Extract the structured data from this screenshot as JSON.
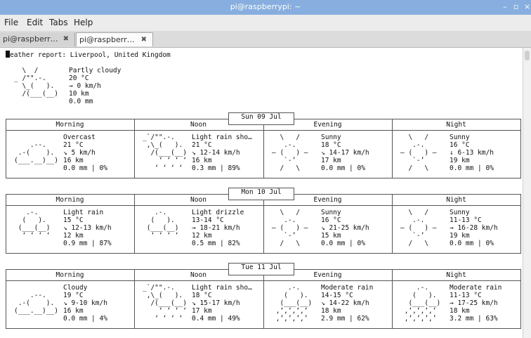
{
  "window": {
    "title": "pi@raspberrypi: ~",
    "minimize": "–",
    "maximize": "▫",
    "close": "×"
  },
  "menu": [
    "File",
    "Edit",
    "Tabs",
    "Help"
  ],
  "tabs": [
    {
      "label": "pi@raspberr…",
      "close": "✖"
    },
    {
      "label": "pi@raspberr…",
      "close": "✖"
    }
  ],
  "report": {
    "cursor_char": "W",
    "header_rest": "eather report: Liverpool, United Kingdom",
    "current": {
      "art": "  \\  /\n_ /\"\".-.\n  \\_(   ).\n  /(___(__)",
      "info": "Partly cloudy\n20 °C\n→ 0 km/h\n10 km\n0.0 mm"
    }
  },
  "columns": [
    "Morning",
    "Noon",
    "Evening",
    "Night"
  ],
  "days": [
    {
      "date": "Sun 09 Jul",
      "cells": [
        {
          "art": "\n    .--.\n .-(    ).\n(___.__)__)",
          "info": "Overcast\n21 °C\n↘ 5 km/h\n16 km\n0.0 mm | 0%"
        },
        {
          "art": "_`/\"\".-.\n ,\\_(   ).\n  /(___(__)\n    ‘ ‘ ‘ ‘\n   ‘ ‘ ‘ ‘",
          "info": "Light rain sho…\n21 °C\n↘ 12-14 km/h\n16 km\n0.3 mm | 89%"
        },
        {
          "art": "  \\   /\n   .-.\n― (   ) ―\n   `-’\n  /   \\",
          "info": "Sunny\n18 °C\n↘ 14-17 km/h\n17 km\n0.0 mm | 0%"
        },
        {
          "art": "  \\   /\n   .-.\n― (   ) ―\n   `-’\n  /   \\",
          "info": "Sunny\n16 °C\n↓ 6-13 km/h\n19 km\n0.0 mm | 0%"
        }
      ]
    },
    {
      "date": "Mon 10 Jul",
      "cells": [
        {
          "art": "   .-.\n  (   ).\n (___(__)\n  ‘ ‘ ‘ ‘",
          "info": "Light rain\n15 °C\n↘ 12-13 km/h\n12 km\n0.9 mm | 87%"
        },
        {
          "art": "   .-.\n  (   ).\n (___(__)\n  ‘ ‘ ‘ ‘",
          "info": "Light drizzle\n13-14 °C\n→ 18-21 km/h\n12 km\n0.5 mm | 82%"
        },
        {
          "art": "  \\   /\n   .-.\n― (   ) ―\n   `-’\n  /   \\",
          "info": "Sunny\n16 °C\n↘ 21-25 km/h\n15 km\n0.0 mm | 0%"
        },
        {
          "art": "  \\   /\n   .-.\n― (   ) ―\n   `-’\n  /   \\",
          "info": "Sunny\n11-13 °C\n→ 16-28 km/h\n19 km\n0.0 mm | 0%"
        }
      ]
    },
    {
      "date": "Tue 11 Jul",
      "cells": [
        {
          "art": "\n    .--.\n .-(    ).\n(___.__)__)",
          "info": "Cloudy\n19 °C\n↘ 9-10 km/h\n16 km\n0.0 mm | 4%"
        },
        {
          "art": "_`/\"\".-.\n ,\\_(   ).\n  /(___(__)\n    ‘ ‘ ‘ ‘\n   ‘ ‘ ‘ ‘",
          "info": "Light rain sho…\n18 °C\n↘ 15-17 km/h\n17 km\n0.4 mm | 49%"
        },
        {
          "art": "    .-.\n   (   ).\n  (___(__)\n ‚‘‚‘‚‘‚‘\n ‚’‚’‚’‚’",
          "info": "Moderate rain\n14-15 °C\n↘ 14-22 km/h\n18 km\n2.9 mm | 62%"
        },
        {
          "art": "    .-.\n   (   ).\n  (___(__)\n ‚‘‚‘‚‘‚‘\n ‚’‚’‚’‚’",
          "info": "Moderate rain\n11-13 °C\n→ 17-25 km/h\n18 km\n3.2 mm | 63%"
        }
      ]
    }
  ]
}
